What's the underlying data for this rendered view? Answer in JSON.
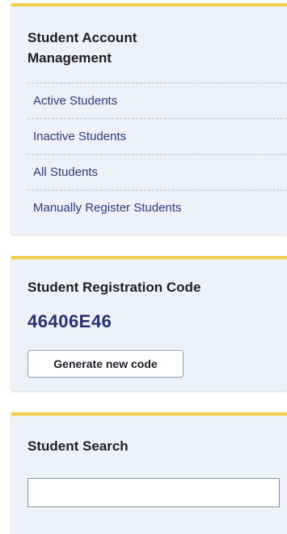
{
  "account_management": {
    "title": "Student Account Management",
    "links": [
      {
        "label": "Active Students"
      },
      {
        "label": "Inactive Students"
      },
      {
        "label": "All Students"
      },
      {
        "label": "Manually Register Students"
      }
    ]
  },
  "registration": {
    "title": "Student Registration Code",
    "code": "46406E46",
    "generate_label": "Generate new code"
  },
  "search": {
    "title": "Student Search",
    "value": "",
    "placeholder": ""
  },
  "colors": {
    "accent_bar": "#f5cd4c",
    "panel_bg": "#eef1f8",
    "link": "#2b3b82",
    "code": "#233173"
  }
}
